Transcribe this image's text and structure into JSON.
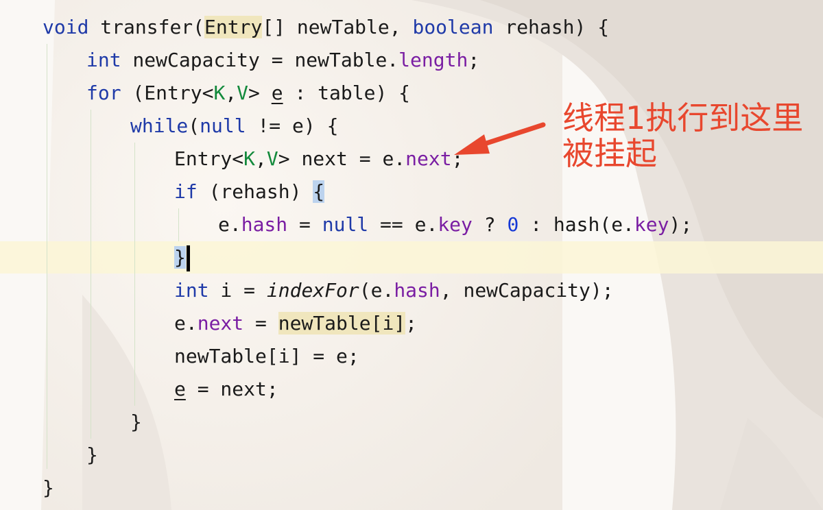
{
  "annotation": {
    "line1": "线程1执行到这里",
    "line2": "被挂起",
    "color": "#e8472e"
  },
  "code": {
    "l1": {
      "a": "void",
      "b": " transfer(",
      "c": "Entry",
      "d": "[] newTable, ",
      "e": "boolean",
      "f": " rehash) {"
    },
    "l2": {
      "a": "int",
      "b": " newCapacity = newTable.",
      "c": "length",
      "d": ";"
    },
    "l3": {
      "a": "for",
      "b": " (Entry<",
      "c": "K",
      "d": ",",
      "e": "V",
      "f": "> ",
      "g": "e",
      "h": " : table) {"
    },
    "l4": {
      "a": "while",
      "b": "(",
      "c": "null",
      "d": " != e) {"
    },
    "l5": {
      "a": "Entry<",
      "b": "K",
      "c": ",",
      "d": "V",
      "e": "> next = e.",
      "f": "next",
      "g": ";"
    },
    "l6": {
      "a": "if",
      "b": " (rehash) ",
      "c": "{"
    },
    "l7": {
      "a": "e.",
      "b": "hash",
      "c": " = ",
      "d": "null",
      "e": " == e.",
      "f": "key",
      "g": " ? ",
      "h": "0",
      "i": " : hash(e.",
      "j": "key",
      "k": ");"
    },
    "l8": {
      "a": "}"
    },
    "l9": {
      "a": "int",
      "b": " i = ",
      "c": "indexFor",
      "d": "(e.",
      "e": "hash",
      "f": ", newCapacity);"
    },
    "l10": {
      "a": "e.",
      "b": "next",
      "c": " = ",
      "d": "newTable[i]",
      "e": ";"
    },
    "l11": {
      "a": "newTable[i] = e;"
    },
    "l12": {
      "a": "e",
      "b": " = next;"
    },
    "l13": {
      "a": "}"
    },
    "l14": {
      "a": "}"
    },
    "l15": {
      "a": "}"
    }
  },
  "colors": {
    "keyword": "#1f3aa8",
    "field": "#7a1ea3",
    "number": "#1639d6",
    "type_param": "#138a3c",
    "current_line": "#fbf6d6",
    "brace_match": "#bcd3ee",
    "usage_highlight": "#f0e6bd"
  }
}
